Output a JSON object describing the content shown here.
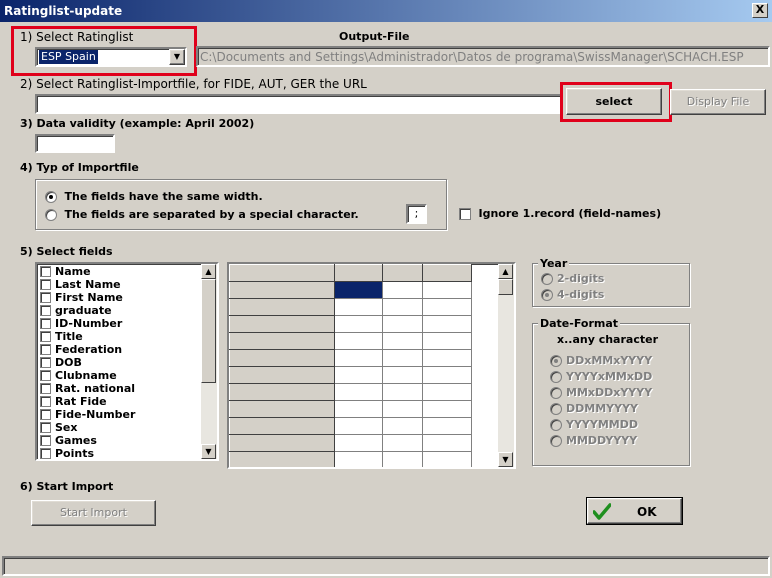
{
  "window": {
    "title": "Ratinglist-update",
    "close_glyph": "X"
  },
  "section1": {
    "label": "1) Select Ratinglist",
    "selected": "ESP  Spain",
    "output_label": "Output-File",
    "output_path": "C:\\Documents and Settings\\Administrador\\Datos de programa\\SwissManager\\SCHACH.ESP"
  },
  "section2": {
    "label": "2) Select Ratinglist-Importfile, for FIDE, AUT, GER the URL",
    "value": "",
    "select_label": "select",
    "display_label": "Display File"
  },
  "section3": {
    "label": "3) Data validity (example: April 2002)",
    "value": ""
  },
  "section4": {
    "label": "4) Typ of Importfile",
    "option_width": "The fields have the same width.",
    "option_separated": "The fields are separated by a special character.",
    "separator": ";",
    "ignore_label": "Ignore 1.record (field-names)",
    "selected": "width"
  },
  "section5": {
    "label": "5) Select fields",
    "fields": [
      "Name",
      "Last Name",
      "First Name",
      "graduate",
      "ID-Number",
      "Title",
      "Federation",
      "DOB",
      "Clubname",
      "Rat. national",
      "Rat Fide",
      "Fide-Number",
      "Sex",
      "Games",
      "Points"
    ],
    "year": {
      "title": "Year",
      "options": [
        "2-digits",
        "4-digits"
      ],
      "selected": "4-digits"
    },
    "date_format": {
      "title": "Date-Format",
      "hint": "x..any character",
      "options": [
        "DDxMMxYYYY",
        "YYYYxMMxDD",
        "MMxDDxYYYY",
        "DDMMYYYY",
        "YYYYMMDD",
        "MMDDYYYY"
      ],
      "selected": "DDxMMxYYYY"
    }
  },
  "section6": {
    "label": "6) Start Import",
    "start_label": "Start Import",
    "ok_label": "OK"
  },
  "icons": {
    "dropdown": "triangle-down-icon",
    "ok": "checkmark-icon",
    "close": "close-icon"
  },
  "colors": {
    "highlight": "#e0001b",
    "selection": "#0a246a",
    "ok_check": "#1f8f1f"
  }
}
